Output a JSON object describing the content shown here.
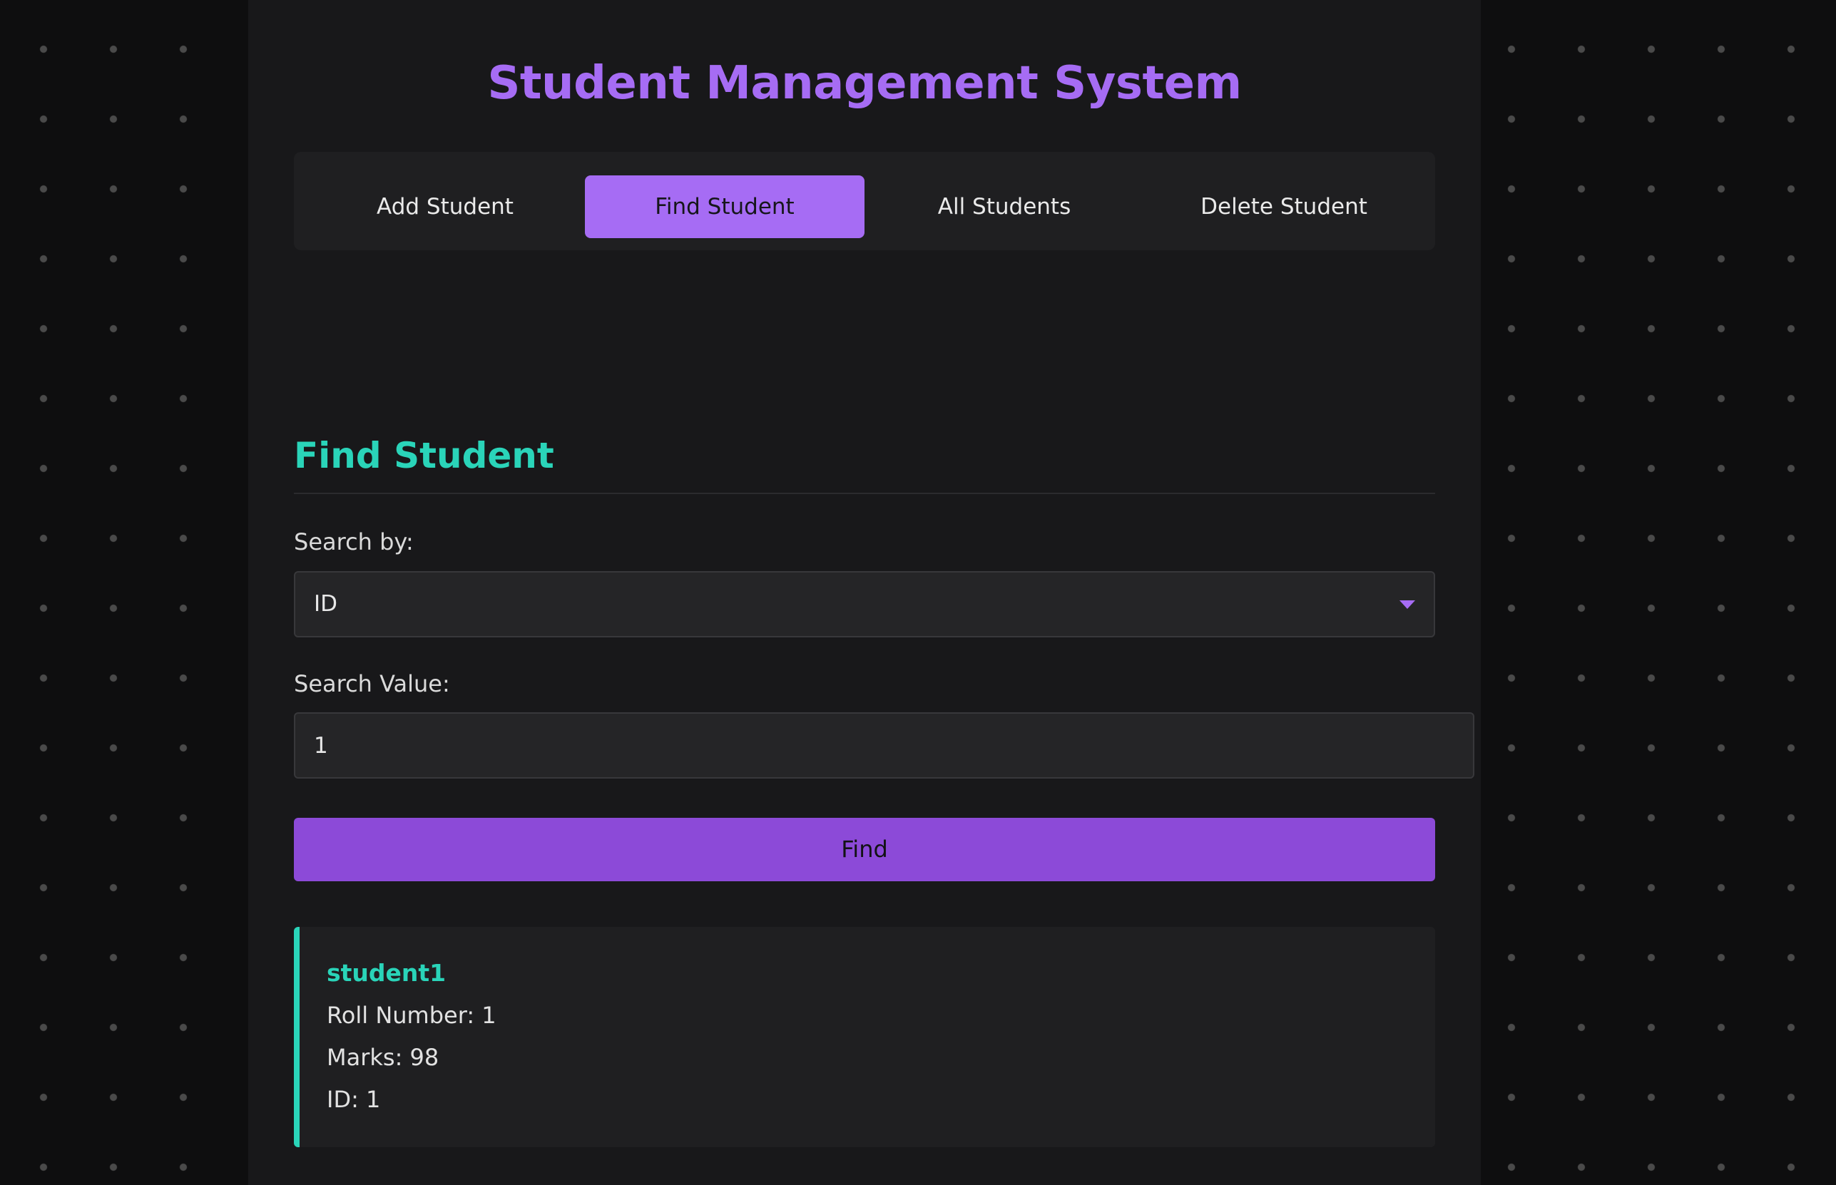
{
  "app": {
    "title": "Student Management System"
  },
  "nav": {
    "tabs": [
      {
        "label": "Add Student",
        "active": false
      },
      {
        "label": "Find Student",
        "active": true
      },
      {
        "label": "All Students",
        "active": false
      },
      {
        "label": "Delete Student",
        "active": false
      }
    ]
  },
  "find_form": {
    "heading": "Find Student",
    "search_by_label": "Search by:",
    "search_by_value": "ID",
    "search_value_label": "Search Value:",
    "search_value": "1",
    "find_button_label": "Find"
  },
  "result": {
    "name": "student1",
    "roll_number_label": "Roll Number:",
    "roll_number": "1",
    "marks_label": "Marks:",
    "marks": "98",
    "id_label": "ID:",
    "id": "1"
  },
  "colors": {
    "accent_purple": "#a66cf4",
    "button_purple": "#8c4ad8",
    "accent_teal": "#2ad4b9",
    "panel_bg": "#18181a",
    "page_bg": "#0e0e0f"
  },
  "icons": {
    "select_caret": "caret-down-icon"
  }
}
